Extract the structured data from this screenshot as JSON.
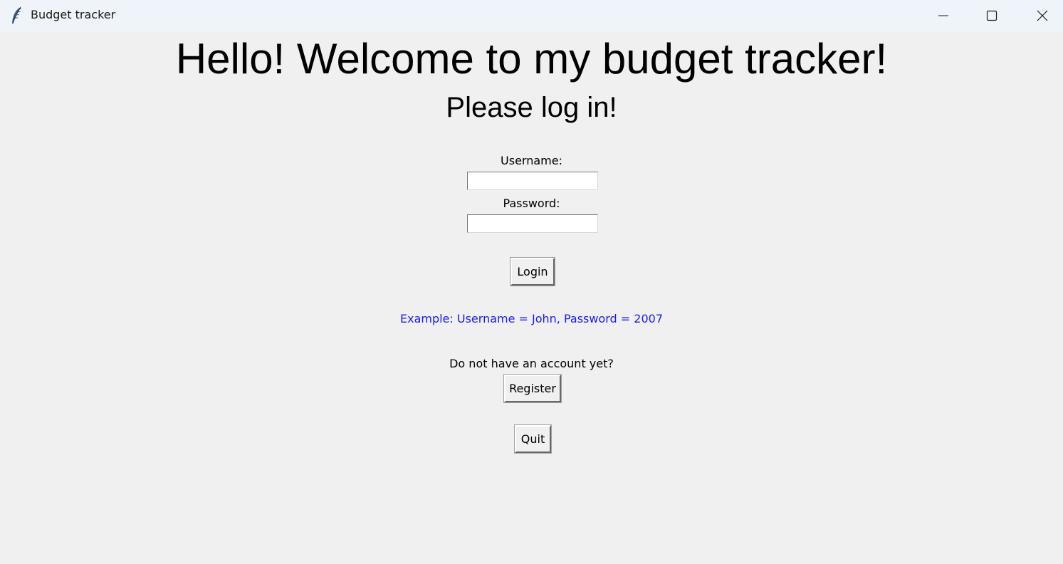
{
  "window": {
    "title": "Budget tracker",
    "icon": "feather-icon",
    "controls": {
      "minimize": "minimize-icon",
      "maximize": "maximize-icon",
      "close": "close-icon"
    }
  },
  "main": {
    "heading": "Hello! Welcome to my budget tracker!",
    "subheading": "Please log in!",
    "username_label": "Username:",
    "username_value": "",
    "password_label": "Password:",
    "password_value": "",
    "login_button": "Login",
    "example_text": "Example: Username = John, Password = 2007",
    "register_prompt": "Do not have an account yet?",
    "register_button": "Register",
    "quit_button": "Quit"
  },
  "colors": {
    "background": "#f0f0f0",
    "titlebar": "#eef4f9",
    "hint_text": "#1a1aff",
    "text": "#000000"
  }
}
